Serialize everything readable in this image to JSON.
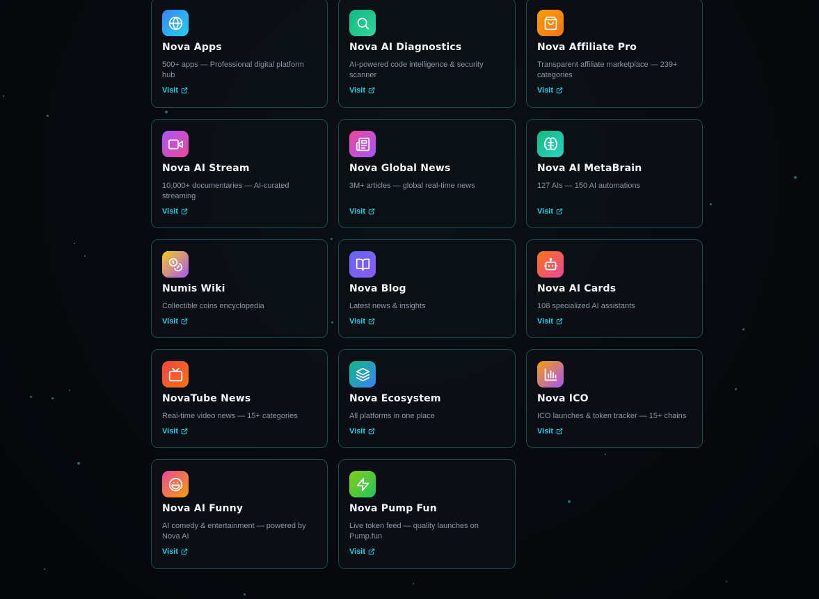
{
  "cards": [
    {
      "title": "Nova Apps",
      "description": "500+ apps — Professional digital platform hub",
      "link_label": "Visit",
      "icon": "globe-icon",
      "gradient": [
        "#3b82f6",
        "#22d3ee"
      ]
    },
    {
      "title": "Nova AI Diagnostics",
      "description": "AI-powered code intelligence & security scanner",
      "link_label": "Visit",
      "icon": "search-icon",
      "gradient": [
        "#10b981",
        "#34d399"
      ]
    },
    {
      "title": "Nova Affiliate Pro",
      "description": "Transparent affiliate marketplace — 239+ categories",
      "link_label": "Visit",
      "icon": "shopping-bag-icon",
      "gradient": [
        "#f59e0b",
        "#f97316"
      ]
    },
    {
      "title": "Nova AI Stream",
      "description": "10,000+ documentaries — AI-curated streaming",
      "link_label": "Visit",
      "icon": "video-camera-icon",
      "gradient": [
        "#a855f7",
        "#ec4899"
      ]
    },
    {
      "title": "Nova Global News",
      "description": "3M+ articles — global real-time news",
      "link_label": "Visit",
      "icon": "newspaper-icon",
      "gradient": [
        "#ec4899",
        "#a855f7"
      ]
    },
    {
      "title": "Nova AI MetaBrain",
      "description": "127 AIs — 150 AI automations",
      "link_label": "Visit",
      "icon": "brain-icon",
      "gradient": [
        "#10b981",
        "#2dd4bf"
      ]
    },
    {
      "title": "Numis Wiki",
      "description": "Collectible coins encyclopedia",
      "link_label": "Visit",
      "icon": "coins-icon",
      "gradient": [
        "#facc15",
        "#a855f7"
      ]
    },
    {
      "title": "Nova Blog",
      "description": "Latest news & insights",
      "link_label": "Visit",
      "icon": "book-open-icon",
      "gradient": [
        "#6366f1",
        "#8b5cf6"
      ]
    },
    {
      "title": "Nova AI Cards",
      "description": "108 specialized AI assistants",
      "link_label": "Visit",
      "icon": "robot-icon",
      "gradient": [
        "#f97316",
        "#ec4899"
      ]
    },
    {
      "title": "NovaTube News",
      "description": "Real-time video news — 15+ categories",
      "link_label": "Visit",
      "icon": "tv-icon",
      "gradient": [
        "#ef4444",
        "#f97316"
      ]
    },
    {
      "title": "Nova Ecosystem",
      "description": "All platforms in one place",
      "link_label": "Visit",
      "icon": "layers-icon",
      "gradient": [
        "#10b981",
        "#3b82f6"
      ]
    },
    {
      "title": "Nova ICO",
      "description": "ICO launches & token tracker — 15+ chains",
      "link_label": "Visit",
      "icon": "bar-chart-icon",
      "gradient": [
        "#f59e0b",
        "#a855f7"
      ]
    },
    {
      "title": "Nova AI Funny",
      "description": "AI comedy & entertainment — powered by Nova AI",
      "link_label": "Visit",
      "icon": "laugh-icon",
      "gradient": [
        "#ec4899",
        "#f59e0b"
      ]
    },
    {
      "title": "Nova Pump Fun",
      "description": "Live token feed — quality launches on Pump.fun",
      "link_label": "Visit",
      "icon": "lightning-icon",
      "gradient": [
        "#84cc16",
        "#22c55e"
      ]
    }
  ],
  "colors": {
    "accent": "#22d3ee",
    "card_border": "#1b4d54",
    "title": "#f2f5f8",
    "description": "#8996a6"
  }
}
